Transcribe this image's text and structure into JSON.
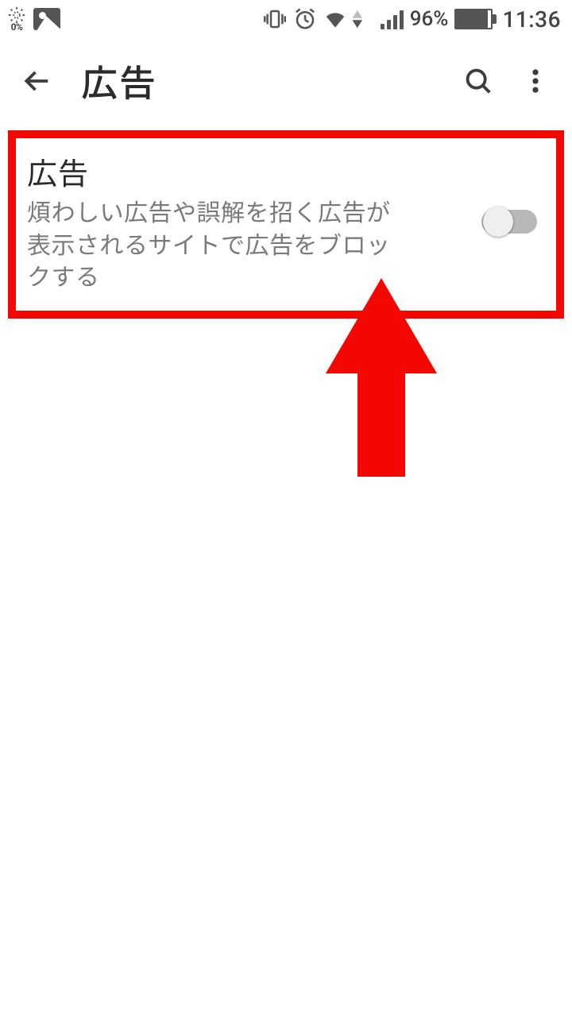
{
  "status": {
    "brightness_pct": "0%",
    "battery_pct": "96%",
    "time": "11:36"
  },
  "appbar": {
    "title": "広告"
  },
  "setting": {
    "title": "広告",
    "subtitle": "煩わしい広告や誤解を招く広告が表示されるサイトで広告をブロックする",
    "toggle_on": false
  },
  "annotation": {
    "highlight_color": "#f40700"
  }
}
